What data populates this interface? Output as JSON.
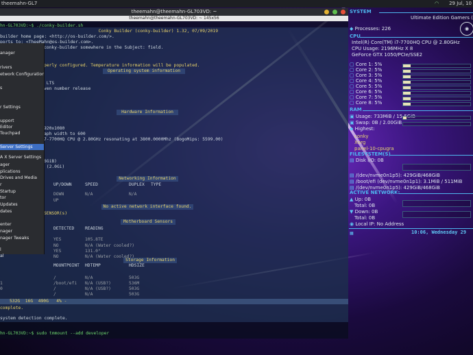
{
  "panel": {
    "left_title": "theemahn-GL7",
    "right_clock": "29 Jul, 10"
  },
  "terminal": {
    "title": "theemahn@theemahn-GL703VD: ~",
    "subtitle": "theemahn@theemahn-GL703VD: ~ 145x56",
    "prompt_line": "hn-GL703VD:~$ ./conky-builder.sh",
    "banner": "Conky Builder (conky-builder) 1.32, 07/09/2019",
    "lines": [
      "builder home page: <http://os-builder.com/>.",
      "ports to: <TheeMahn@os-builder.com>.",
      "conky-builder somewhere in the Subject: field.",
      "perly configured. Temperature information will be populated.",
      " LTS",
      "ven number release",
      "920x1080",
      "aph width to 600",
      "7-7700HQ CPU @ 2.80GHz resonating at 3800.0000Mhz (BogoMips: 5599.00)",
      "6GiB)",
      " (2.0Gi)",
      "complete.",
      "system detection complete.",
      "hn-GL703VD:~$ sudo tmmount --add developer"
    ],
    "headers": {
      "os": "Operating system information",
      "hw": "Hardware Information",
      "net": "Networking Information",
      "mb": "Motherboard Sensors",
      "storage": "Storage Information",
      "no_net": "No active network interface found."
    },
    "net_cols": [
      "UP/DOWN",
      "SPEED",
      "DUPLEX",
      "TYPE"
    ],
    "net_rows": [
      [
        "DOWN",
        "N/A",
        "N/A"
      ],
      [
        "UP"
      ]
    ],
    "sensor_cols": [
      "DETECTED",
      "READING"
    ],
    "sensor_label": "SENSOR(s)",
    "sensor_rows": [
      [
        "YES",
        "105.8TE"
      ],
      [
        "NO",
        "N/A (Water cooled?)"
      ],
      [
        "YES",
        "131.0°"
      ],
      [
        "NO",
        "N/A (Water cooled?)"
      ]
    ],
    "storage_cols": [
      "MOUNTPOINT",
      "HDTEMP",
      "HDSIZE"
    ],
    "storage_rows": [
      [
        "/",
        "N/A",
        "503G"
      ],
      [
        "/boot/efi",
        "N/A (USB?)",
        "536M"
      ],
      [
        "/",
        "N/A (USB?)",
        "503G"
      ],
      [
        "/",
        "N/A",
        "503G"
      ]
    ],
    "storage_dev_prefix": [
      "1",
      "0",
      ""
    ],
    "total_row": "532G  16G  490G   4% -"
  },
  "menu": {
    "items": [
      "anager",
      "rivers",
      "etwork Configuration",
      "s",
      "r Settings",
      "upport",
      "Editor",
      "Touchpad",
      "Server Settings",
      "A X Server Settings",
      "ager",
      "plications",
      "Drives and Media",
      "r",
      "Startup",
      "tor",
      "Updates",
      "dates",
      "enter",
      "nager",
      "nager Tweaks",
      "l",
      "al"
    ],
    "selected_index": 8
  },
  "conky": {
    "system_label": "SYSTEM",
    "machine": "Ultimate Edition Gamers (E",
    "processes": "Processes: 226",
    "cpu_label": "CPU",
    "cpu_model": "Intel(R) Core(TM) i7-7700HQ CPU @ 2.80GHz",
    "cpu_usage": "CPU Usage:  2196MHz X 8",
    "gpu": "GeForce GTX 1050/PCIe/SSE2",
    "cores": [
      {
        "label": "Core 1: 5%",
        "pct": 5
      },
      {
        "label": "Core 2: 5%",
        "pct": 5
      },
      {
        "label": "Core 3: 5%",
        "pct": 5
      },
      {
        "label": "Core 4: 5%",
        "pct": 5
      },
      {
        "label": "Core 5: 5%",
        "pct": 5
      },
      {
        "label": "Core 6: 5%",
        "pct": 5
      },
      {
        "label": "Core 7: 5%",
        "pct": 5
      },
      {
        "label": "Core 8: 5%",
        "pct": 5
      }
    ],
    "ram_label": "RAM",
    "ram_usage": "Usage: 733MiB / 15.5GiB",
    "ram_pct": 5,
    "swap": "Swap: 0B / 2.00GiB",
    "highest_label": "Highest:",
    "highest": [
      "conky",
      "Xorg",
      "panel-10-cpugra"
    ],
    "fs_label": "FILESYSTEM(S)",
    "disk_io": "Disk I/O: 0B",
    "fs": [
      {
        "label": "/(dev/nvme0n1p5):  429GiB/468GiB"
      },
      {
        "label": "/boot/efi (dev/nvme0n1p1): 3.1MiB / 511MiB"
      },
      {
        "label": "/(dev/nvme0n1p5):  429GiB/468GiB"
      }
    ],
    "net_label": "ACTIVE NETWORK:",
    "up": "Up: 0B",
    "total1": "Total: 0B",
    "down": "Down: 0B",
    "total2": "Total: 0B",
    "local_ip": "Local IP: No Address",
    "clock": "10:06, Wednesday 29"
  }
}
